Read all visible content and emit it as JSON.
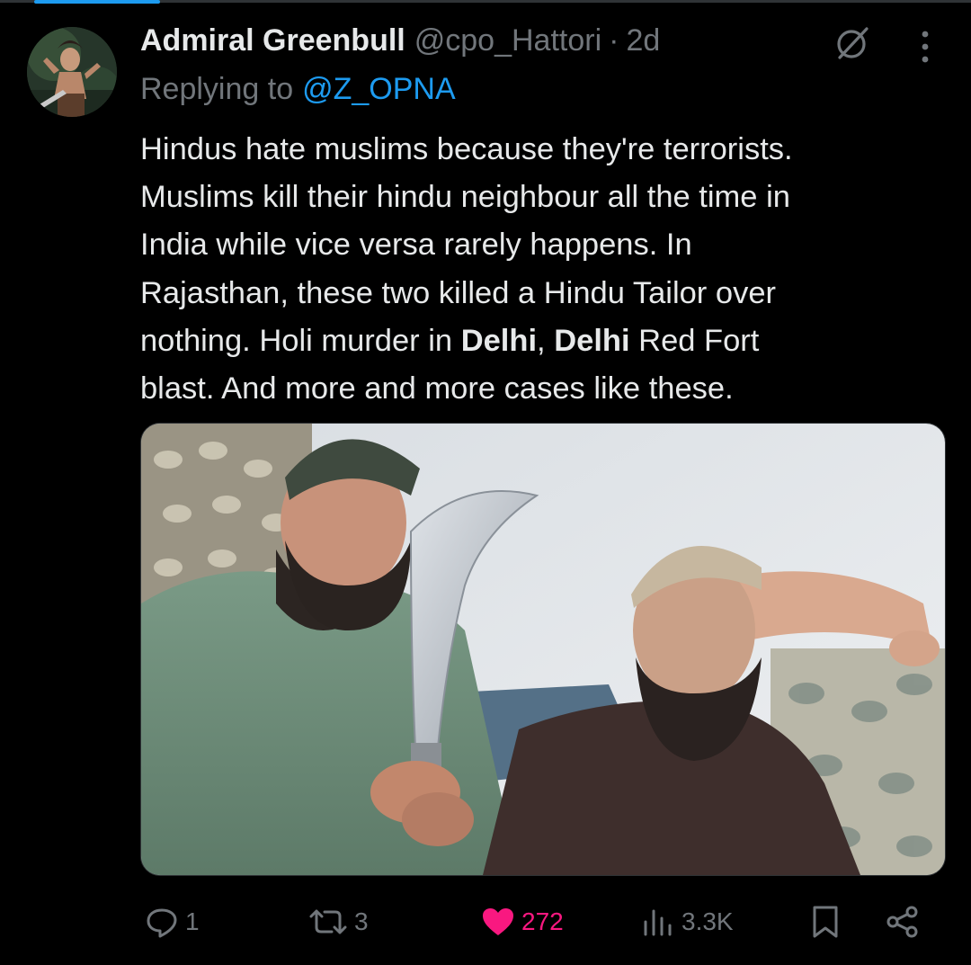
{
  "post": {
    "author_name": "Admiral Greenbull",
    "author_handle": "@cpo_Hattori",
    "separator": "·",
    "time": "2d",
    "replying_label": "Replying to",
    "replying_handle": "@Z_OPNA",
    "text_lines": [
      "Hindus hate muslims because they're terrorists.",
      "Muslims kill their hindu neighbour all the time in",
      "India while vice versa rarely happens. In",
      "Rajasthan, these two killed a Hindu Tailor over",
      {
        "before": "nothing. Holi murder in ",
        "bold1": "Delhi",
        "mid": ", ",
        "bold2": "Delhi",
        "after": " Red Fort"
      },
      "blast. And more and more cases like these."
    ]
  },
  "actions": {
    "reply_count": "1",
    "repost_count": "3",
    "like_count": "272",
    "views_count": "3.3K"
  },
  "icons": {
    "reply": "reply-icon",
    "repost": "repost-icon",
    "like": "heart-filled-icon",
    "views": "views-icon",
    "bookmark": "bookmark-icon",
    "share": "share-icon",
    "grok": "grok-icon",
    "more": "more-vertical-icon"
  },
  "colors": {
    "background": "#000000",
    "text": "#e7e9ea",
    "muted": "#71767b",
    "link": "#1d9bf0",
    "like": "#f91880"
  }
}
